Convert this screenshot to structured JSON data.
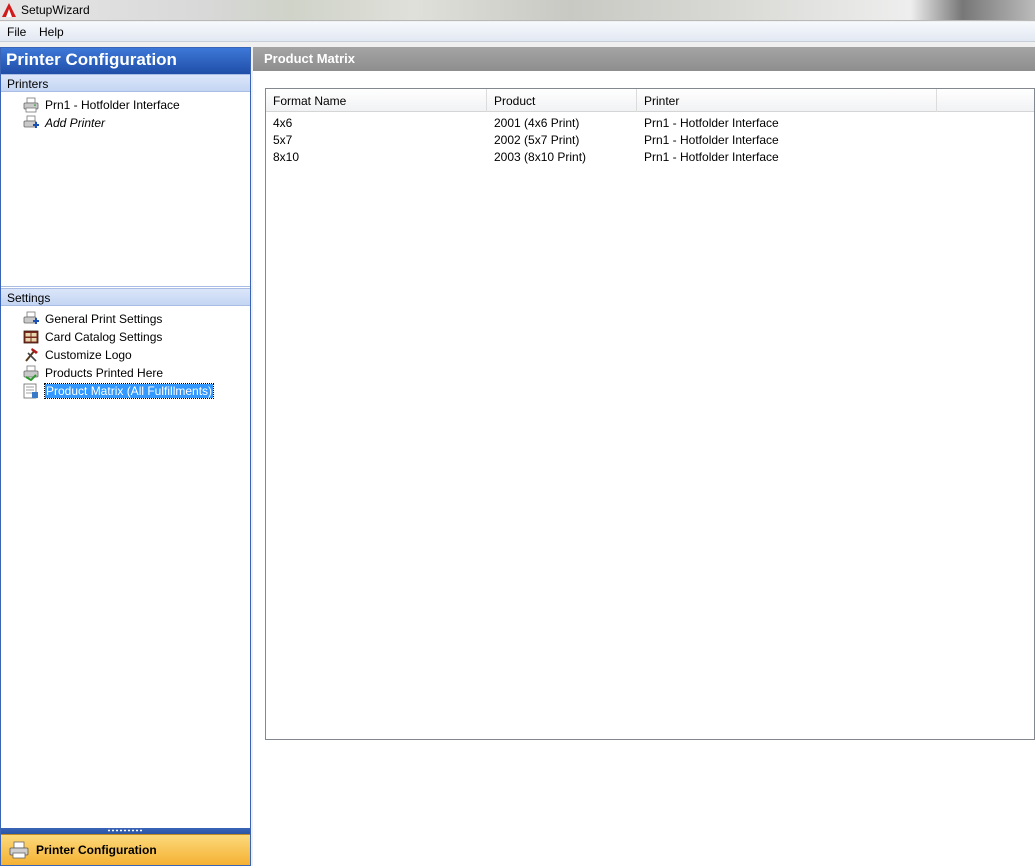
{
  "window": {
    "title": "SetupWizard"
  },
  "menu": {
    "file": "File",
    "help": "Help"
  },
  "sidebar": {
    "title": "Printer Configuration",
    "printers_section": "Printers",
    "printers": [
      {
        "label": "Prn1 - Hotfolder Interface",
        "icon": "printer-icon"
      },
      {
        "label": "Add Printer",
        "icon": "add-printer-icon"
      }
    ],
    "settings_section": "Settings",
    "settings": [
      {
        "label": "General Print Settings",
        "icon": "print-settings-icon"
      },
      {
        "label": "Card Catalog Settings",
        "icon": "card-catalog-icon"
      },
      {
        "label": "Customize Logo",
        "icon": "tools-icon"
      },
      {
        "label": "Products Printed Here",
        "icon": "products-printer-icon"
      },
      {
        "label": "Product Matrix (All Fulfillments)",
        "icon": "product-matrix-icon",
        "selected": true
      }
    ],
    "nav_button": "Printer Configuration"
  },
  "main": {
    "title": "Product Matrix",
    "columns": [
      "Format Name",
      "Product",
      "Printer",
      ""
    ],
    "rows": [
      {
        "format": "4x6",
        "product": "2001 (4x6 Print)",
        "printer": "Prn1 - Hotfolder Interface"
      },
      {
        "format": "5x7",
        "product": "2002 (5x7 Print)",
        "printer": "Prn1 - Hotfolder Interface"
      },
      {
        "format": "8x10",
        "product": "2003 (8x10 Print)",
        "printer": "Prn1 - Hotfolder Interface"
      }
    ]
  },
  "colors": {
    "accent_blue": "#1f4ea8",
    "selection": "#3399ff",
    "nav_gold": "#f5b133",
    "header_gray": "#9a9a9a"
  }
}
